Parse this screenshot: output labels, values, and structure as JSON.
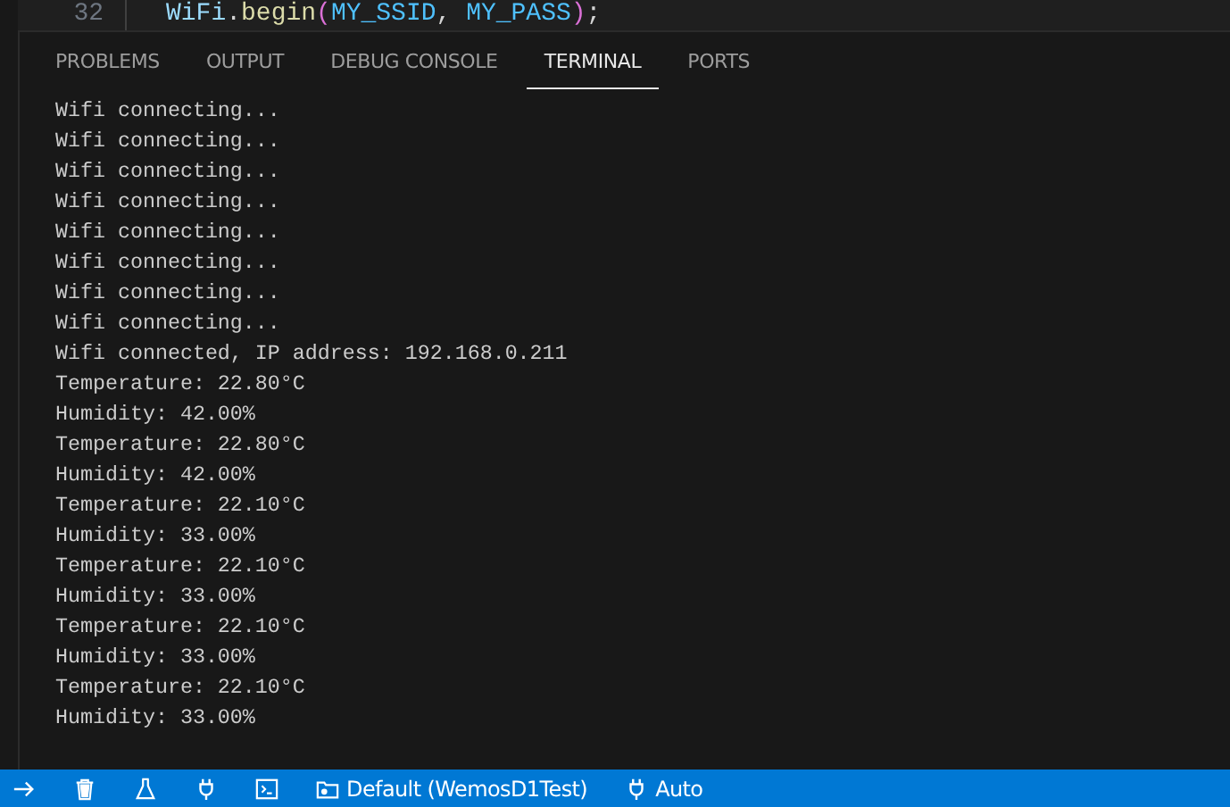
{
  "editor": {
    "line_number": "32",
    "code": [
      {
        "kind": "variable",
        "text": "WiFi"
      },
      {
        "kind": "plain",
        "text": "."
      },
      {
        "kind": "function",
        "text": "begin"
      },
      {
        "kind": "bracket",
        "text": "("
      },
      {
        "kind": "constant",
        "text": "MY_SSID"
      },
      {
        "kind": "plain",
        "text": ", "
      },
      {
        "kind": "constant",
        "text": "MY_PASS"
      },
      {
        "kind": "bracket",
        "text": ")"
      },
      {
        "kind": "plain",
        "text": ";"
      }
    ]
  },
  "tabs": [
    {
      "label": "PROBLEMS",
      "selected": false
    },
    {
      "label": "OUTPUT",
      "selected": false
    },
    {
      "label": "DEBUG CONSOLE",
      "selected": false
    },
    {
      "label": "TERMINAL",
      "selected": true
    },
    {
      "label": "PORTS",
      "selected": false
    }
  ],
  "terminal": {
    "lines": [
      "Wifi connecting...",
      "Wifi connecting...",
      "Wifi connecting...",
      "Wifi connecting...",
      "Wifi connecting...",
      "Wifi connecting...",
      "Wifi connecting...",
      "Wifi connecting...",
      "Wifi connected, IP address: 192.168.0.211",
      "Temperature: 22.80°C",
      "Humidity: 42.00%",
      "Temperature: 22.80°C",
      "Humidity: 42.00%",
      "Temperature: 22.10°C",
      "Humidity: 33.00%",
      "Temperature: 22.10°C",
      "Humidity: 33.00%",
      "Temperature: 22.10°C",
      "Humidity: 33.00%",
      "Temperature: 22.10°C",
      "Humidity: 33.00%"
    ]
  },
  "status_bar": {
    "items": [
      {
        "kind": "arrow"
      },
      {
        "kind": "trash"
      },
      {
        "kind": "flask"
      },
      {
        "kind": "plug"
      },
      {
        "kind": "terminal"
      },
      {
        "kind": "folder",
        "label": "Default (WemosD1Test)"
      },
      {
        "kind": "plug",
        "label": "Auto"
      }
    ]
  }
}
